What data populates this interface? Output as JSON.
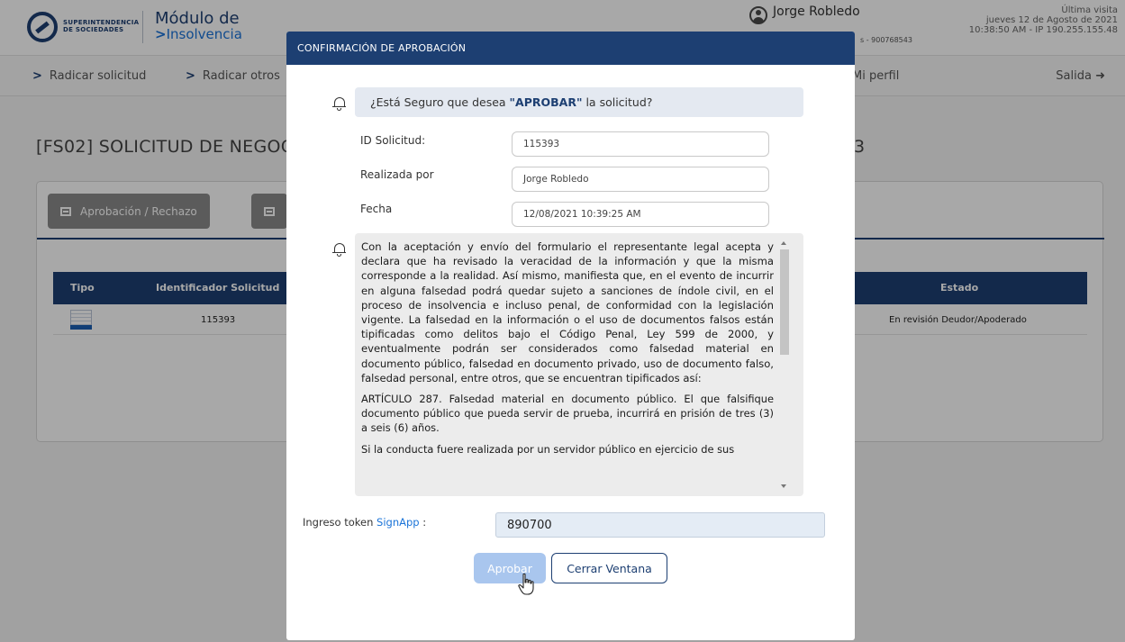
{
  "header": {
    "logo_text": "SUPERINTENDENCIA DE SOCIEDADES",
    "module_title": "Módulo de",
    "module_subtitle": "Insolvencia",
    "user_name": "Jorge Robledo",
    "user_sub": "s - 900768543",
    "last_visit_label": "Última visita",
    "last_visit_date": "jueves 12 de Agosto de 2021",
    "last_visit_time_ip": "10:38:50 AM - IP 190.255.155.48"
  },
  "nav": {
    "items": [
      "Radicar solicitud",
      "Radicar otros",
      "Mi perfil"
    ],
    "logout": "Salida"
  },
  "page": {
    "title": "[FS02] SOLICITUD DE NEGOC",
    "title_tail": "3",
    "tabs": [
      "Aprobación / Rechazo"
    ],
    "table": {
      "headers": [
        "Tipo",
        "Identificador Solicitud",
        "Estado"
      ],
      "row": {
        "id": "115393",
        "estado": "En revisión Deudor/Apoderado"
      }
    }
  },
  "modal": {
    "title": "CONFIRMACIÓN DE APROBACIÓN",
    "question_prefix": "¿Está Seguro que desea ",
    "question_bold": "\"APROBAR\"",
    "question_suffix": " la solicitud?",
    "fields": [
      {
        "label": "ID Solicitud:",
        "value": "115393"
      },
      {
        "label": "Realizada por",
        "value": "Jorge Robledo"
      },
      {
        "label": "Fecha",
        "value": "12/08/2021 10:39:25 AM"
      }
    ],
    "legal_paragraphs": [
      "Con la aceptación y envío del formulario el representante legal acepta y declara que ha revisado la veracidad de la información y que la misma corresponde a la realidad. Así mismo, manifiesta que, en el evento de incurrir en alguna falsedad podrá quedar sujeto a sanciones de índole civil, en el proceso de insolvencia e incluso penal, de conformidad con la legislación vigente. La falsedad en la información o el uso de documentos falsos están tipificadas como delitos bajo el Código Penal, Ley 599 de 2000, y eventualmente podrán ser considerados como falsedad material en documento público, falsedad en documento privado, uso de documento falso, falsedad personal, entre otros, que se encuentran tipificados así:",
      "ARTÍCULO 287. Falsedad material en documento público. El que falsifique documento público que pueda servir de prueba, incurrirá en prisión de tres (3) a seis (6) años.",
      "Si la conducta fuere realizada por un servidor público en ejercicio de sus"
    ],
    "token_label": "Ingreso token ",
    "token_app": "SignApp",
    "token_colon": " :",
    "token_value": "890700",
    "approve_label": "Aprobar",
    "close_label": "Cerrar Ventana"
  },
  "colors": {
    "primary": "#1d3f72",
    "link": "#1a73d8",
    "approve_disabled": "#a9c6ee"
  }
}
